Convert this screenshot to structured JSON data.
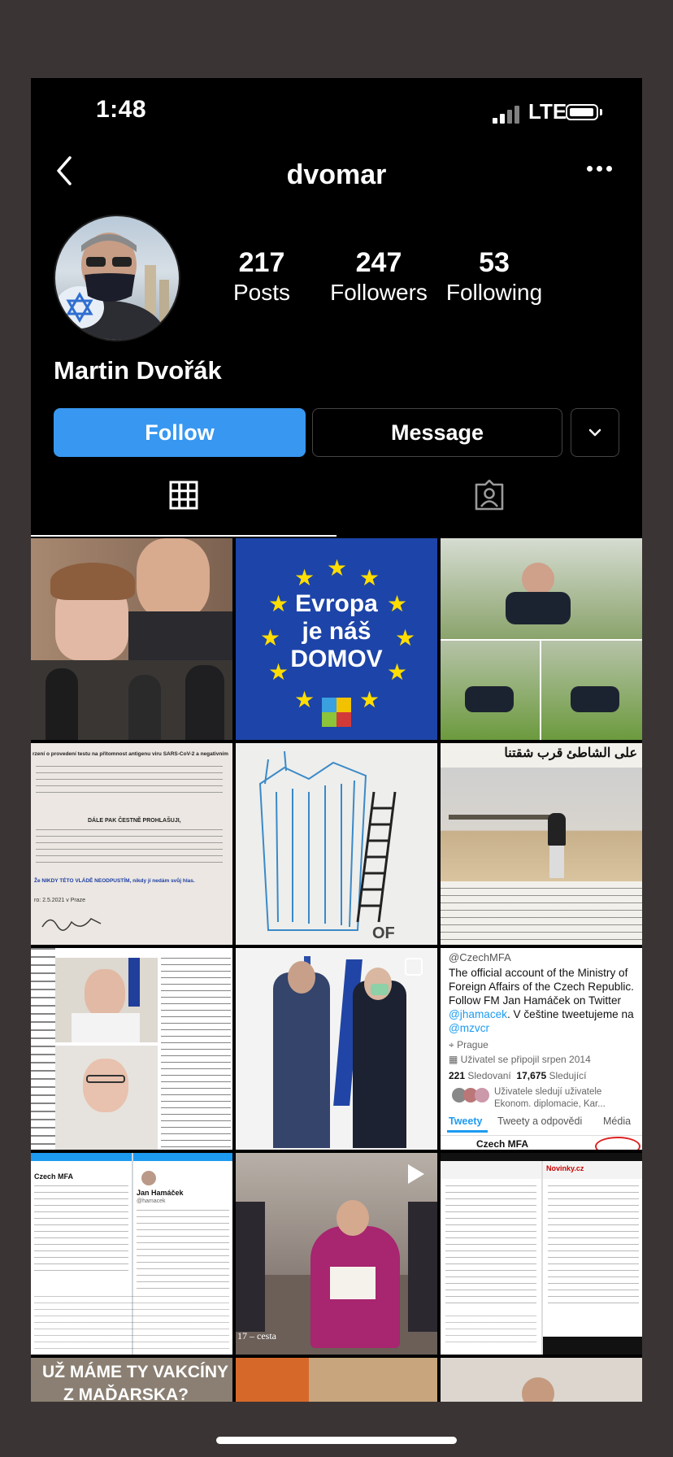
{
  "status_bar": {
    "time": "1:48",
    "network": "LTE"
  },
  "header": {
    "username": "dvomar"
  },
  "profile": {
    "posts_count": "217",
    "posts_label": "Posts",
    "followers_count": "247",
    "followers_label": "Followers",
    "following_count": "53",
    "following_label": "Following",
    "full_name": "Martin Dvořák"
  },
  "actions": {
    "follow_label": "Follow",
    "message_label": "Message"
  },
  "tabs": [
    "grid",
    "tagged"
  ],
  "posts": {
    "p2": {
      "line1": "Evropa",
      "line2": "je náš",
      "line3": "DOMOV"
    },
    "p4": {
      "l1": "rzení o provedení testu na přítomnost antigenu viru SARS-CoV-2 a negativním",
      "l2": "DÁLE PAK ČESTNĚ PROHLAŠUJI,",
      "l3": "Že NIKDY TÉTO VLÁDĚ NEODPUSTÍM, nikdy jí nedám svůj hlas.",
      "l4": "ro: 2.5.2021 v Praze"
    },
    "p6": {
      "headline": "على الشاطئ قرب شقتنا"
    },
    "p9": {
      "handle": "@CzechMFA",
      "bio1": "The official account of the Ministry of",
      "bio2": "Foreign Affairs of the Czech Republic.",
      "bio3": "Follow FM Jan Hamáček on Twitter",
      "bio4a": "@jhamacek",
      "bio4b": ". V češtine tweetujeme na",
      "bio5": "@mzvcr",
      "location": "Prague",
      "joined": "Uživatel se připojil srpen 2014",
      "following_n": "221",
      "following_l": "Sledovaní",
      "followers_n": "17,675",
      "followers_l": "Sledující",
      "followed_by": "Uživatele sledují uživatele",
      "followed_by2": "Ekonom. diplomacie, Kar...",
      "tab1": "Tweety",
      "tab2": "Tweety a odpovědi",
      "tab3": "Média",
      "tail": "Czech MFA"
    },
    "p10": {
      "name1": "Czech MFA",
      "name2": "Jan Hamáček",
      "handle2": "@hamacek"
    },
    "p11": {
      "caption": "17 – cesta"
    },
    "p12": {
      "site": "Novinky.cz"
    },
    "p13": {
      "line1": "UŽ MÁME TY VAKCÍNY",
      "line2": "Z MAĎARSKA?"
    }
  }
}
